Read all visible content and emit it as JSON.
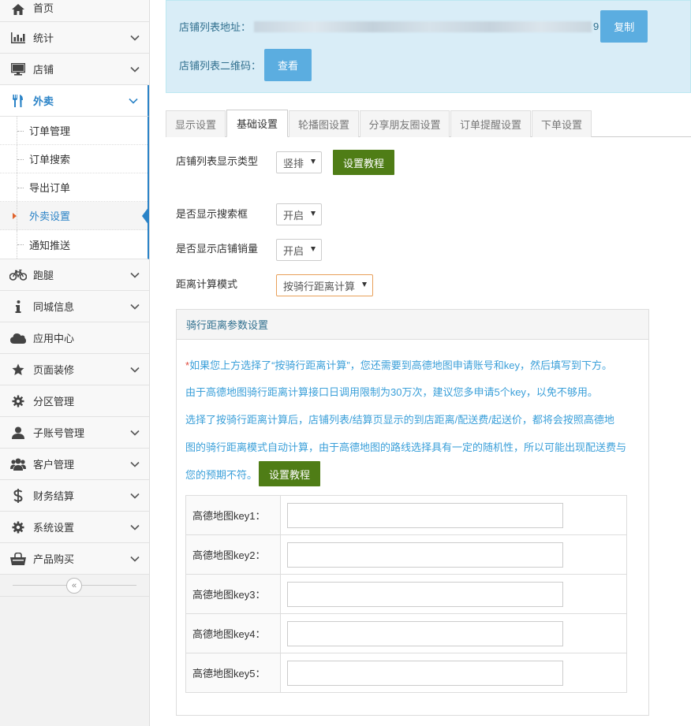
{
  "sidebar": {
    "items": [
      {
        "label": "首页",
        "icon": "home-icon"
      },
      {
        "label": "统计",
        "icon": "bar-chart-icon"
      },
      {
        "label": "店铺",
        "icon": "monitor-icon"
      },
      {
        "label": "外卖",
        "icon": "cutlery-icon"
      },
      {
        "label": "跑腿",
        "icon": "bicycle-icon"
      },
      {
        "label": "同城信息",
        "icon": "info-icon"
      },
      {
        "label": "应用中心",
        "icon": "cloud-icon"
      },
      {
        "label": "页面装修",
        "icon": "star-icon"
      },
      {
        "label": "分区管理",
        "icon": "cog-icon"
      },
      {
        "label": "子账号管理",
        "icon": "user-icon"
      },
      {
        "label": "客户管理",
        "icon": "users-icon"
      },
      {
        "label": "财务结算",
        "icon": "dollar-icon"
      },
      {
        "label": "系统设置",
        "icon": "gear-icon"
      },
      {
        "label": "产品购买",
        "icon": "shopping-bag-icon"
      }
    ],
    "takeout_sub": [
      {
        "label": "订单管理"
      },
      {
        "label": "订单搜索"
      },
      {
        "label": "导出订单"
      },
      {
        "label": "外卖设置"
      },
      {
        "label": "通知推送"
      }
    ],
    "collapse_symbol": "«",
    "accent": "#2a83c7"
  },
  "info": {
    "url_label": "店铺列表地址：",
    "url_tail": "9",
    "copy_button": "复制",
    "qr_label": "店铺列表二维码：",
    "view_button": "查看"
  },
  "tabs": [
    {
      "label": "显示设置"
    },
    {
      "label": "基础设置"
    },
    {
      "label": "轮播图设置"
    },
    {
      "label": "分享朋友圈设置"
    },
    {
      "label": "订单提醒设置"
    },
    {
      "label": "下单设置"
    }
  ],
  "form": {
    "list_type": {
      "label": "店铺列表显示类型",
      "value": "竖排",
      "tutorial": "设置教程"
    },
    "show_search": {
      "label": "是否显示搜索框",
      "value": "开启"
    },
    "show_sales": {
      "label": "是否显示店铺销量",
      "value": "开启"
    },
    "distance_mode": {
      "label": "距离计算模式",
      "value": "按骑行距离计算"
    }
  },
  "panel": {
    "title": "骑行距离参数设置",
    "notes": [
      "如果您上方选择了“按骑行距离计算”，您还需要到高德地图申请账号和key，然后填写到下方。",
      "由于高德地图骑行距离计算接口日调用限制为30万次，建议您多申请5个key，以免不够用。",
      "选择了按骑行距离计算后，店铺列表/结算页显示的到店距离/配送费/起送价，都将会按照高德地",
      "图的骑行距离模式自动计算，由于高德地图的路线选择具有一定的随机性，所以可能出现配送费与",
      "您的预期不符。"
    ],
    "star": "*",
    "tutorial": "设置教程",
    "keys": [
      {
        "label": "高德地图key1：",
        "value": ""
      },
      {
        "label": "高德地图key2：",
        "value": ""
      },
      {
        "label": "高德地图key3：",
        "value": ""
      },
      {
        "label": "高德地图key4：",
        "value": ""
      },
      {
        "label": "高德地图key5：",
        "value": ""
      }
    ]
  },
  "colors": {
    "info_bg": "#d9edf7",
    "blue_button": "#5bade0",
    "green_button": "#4f7d16",
    "note_text": "#3a9fd9"
  }
}
